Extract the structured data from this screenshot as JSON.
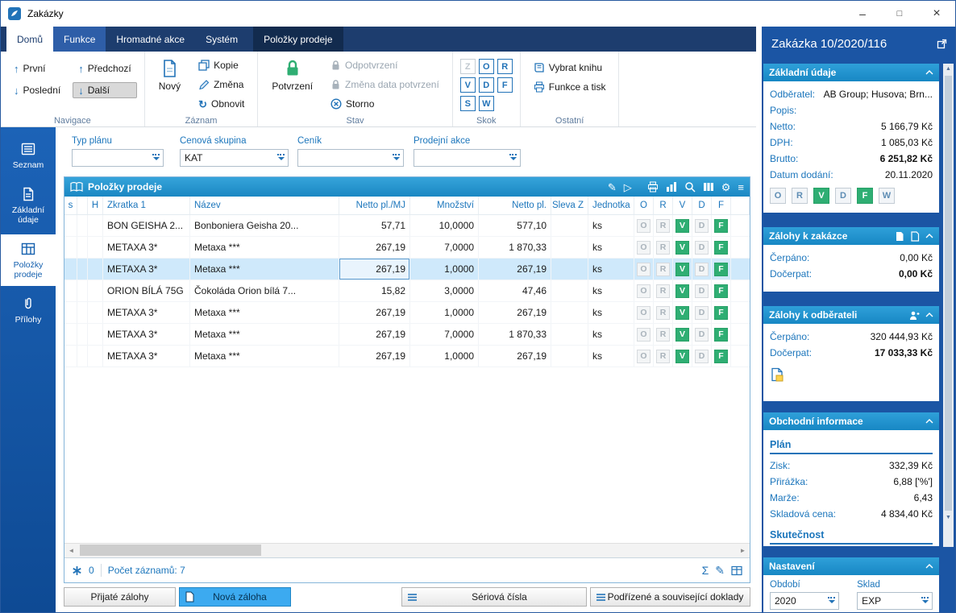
{
  "colors": {
    "ribbon_navy": "#1d3d6e",
    "sidebar_blue": "#1457a8",
    "panel_blue": "#1b55a4",
    "header_blue": "#1b8ac6",
    "label_blue": "#1c76bc",
    "accent_blue": "#2273b8",
    "status_green": "#2fae73",
    "selection_blue": "#cfe9fb"
  },
  "icons": {
    "arrow_up": "↑",
    "arrow_down": "↓",
    "refresh": "↻",
    "play": "▷",
    "gear": "⚙",
    "menu": "≡",
    "sum": "Σ",
    "pencil": "✎",
    "scroll_left": "◄",
    "scroll_right": "►",
    "scroll_up": "▲",
    "scroll_down": "▼",
    "close": "×",
    "maximize": "□",
    "minimize": "–"
  },
  "window": {
    "title": "Zakázky"
  },
  "ribbon": {
    "tabs": [
      {
        "label": "Domů"
      },
      {
        "label": "Funkce"
      },
      {
        "label": "Hromadné akce"
      },
      {
        "label": "Systém"
      },
      {
        "label": "Položky prodeje"
      }
    ],
    "groups": {
      "navigace": {
        "label": "Navigace",
        "first": "První",
        "previous": "Předchozí",
        "last": "Poslední",
        "next": "Další"
      },
      "zaznam": {
        "label": "Záznam",
        "new": "Nový",
        "copy": "Kopie",
        "change": "Změna",
        "refresh": "Obnovit"
      },
      "stav": {
        "label": "Stav",
        "confirm": "Potvrzení",
        "unconfirm": "Odpotvrzení",
        "change_date": "Změna data potvrzení",
        "storno": "Storno"
      },
      "skok": {
        "label": "Skok",
        "letters": [
          "Z",
          "O",
          "R",
          "V",
          "D",
          "F",
          "S",
          "W"
        ]
      },
      "ostatni": {
        "label": "Ostatní",
        "select_book": "Vybrat knihu",
        "functions_print": "Funkce a tisk"
      }
    }
  },
  "sidebar": {
    "items": [
      {
        "label": "Seznam"
      },
      {
        "label": "Základní údaje"
      },
      {
        "label": "Položky prodeje"
      },
      {
        "label": "Přílohy"
      }
    ]
  },
  "filters": [
    {
      "label": "Typ plánu",
      "value": ""
    },
    {
      "label": "Cenová skupina",
      "value": "KAT"
    },
    {
      "label": "Ceník",
      "value": ""
    },
    {
      "label": "Prodejní akce",
      "value": ""
    }
  ],
  "grid": {
    "title": "Položky prodeje",
    "columns": {
      "s": "s",
      "h": "H",
      "zkratka": "Zkratka 1",
      "nazev": "Název",
      "netto_mj": "Netto pl./MJ",
      "mnozstvi": "Množství",
      "netto": "Netto pl.",
      "sleva": "Sleva Z",
      "jednotka": "Jednotka"
    },
    "status_letters": [
      "O",
      "R",
      "V",
      "D",
      "F"
    ],
    "rows": [
      {
        "zkratka": "BON GEISHA 2...",
        "nazev": "Bonboniera Geisha 20...",
        "netto_mj": "57,71",
        "mnozstvi": "10,0000",
        "netto": "577,10",
        "sleva": "",
        "jednotka": "ks"
      },
      {
        "zkratka": "METAXA 3*",
        "nazev": "Metaxa ***",
        "netto_mj": "267,19",
        "mnozstvi": "7,0000",
        "netto": "1 870,33",
        "sleva": "",
        "jednotka": "ks"
      },
      {
        "zkratka": "METAXA 3*",
        "nazev": "Metaxa ***",
        "netto_mj": "267,19",
        "mnozstvi": "1,0000",
        "netto": "267,19",
        "sleva": "",
        "jednotka": "ks"
      },
      {
        "zkratka": "ORION BÍLÁ 75G",
        "nazev": "Čokoláda Orion bílá 7...",
        "netto_mj": "15,82",
        "mnozstvi": "3,0000",
        "netto": "47,46",
        "sleva": "",
        "jednotka": "ks"
      },
      {
        "zkratka": "METAXA 3*",
        "nazev": "Metaxa ***",
        "netto_mj": "267,19",
        "mnozstvi": "1,0000",
        "netto": "267,19",
        "sleva": "",
        "jednotka": "ks"
      },
      {
        "zkratka": "METAXA 3*",
        "nazev": "Metaxa ***",
        "netto_mj": "267,19",
        "mnozstvi": "7,0000",
        "netto": "1 870,33",
        "sleva": "",
        "jednotka": "ks"
      },
      {
        "zkratka": "METAXA 3*",
        "nazev": "Metaxa ***",
        "netto_mj": "267,19",
        "mnozstvi": "1,0000",
        "netto": "267,19",
        "sleva": "",
        "jednotka": "ks"
      }
    ],
    "footer": {
      "counter": "0",
      "records": "Počet záznamů: 7"
    }
  },
  "bottom_buttons": {
    "prijate_zalohy": "Přijaté zálohy",
    "nova_zaloha": "Nová záloha",
    "seriova_cisla": "Sériová čísla",
    "podrizene": "Podřízené a související doklady"
  },
  "panel": {
    "title": "Zakázka 10/2020/116",
    "zakladni": {
      "title": "Základní údaje",
      "fields": [
        {
          "label": "Odběratel:",
          "value": "AB Group; Husova; Brn..."
        },
        {
          "label": "Popis:",
          "value": ""
        },
        {
          "label": "Netto:",
          "value": "5 166,79 Kč"
        },
        {
          "label": "DPH:",
          "value": "1 085,03 Kč"
        },
        {
          "label": "Brutto:",
          "value": "6 251,82 Kč"
        },
        {
          "label": "Datum dodání:",
          "value": "20.11.2020"
        }
      ],
      "status_letters": [
        "O",
        "R",
        "V",
        "D",
        "F",
        "W"
      ]
    },
    "zalohy_zakazka": {
      "title": "Zálohy k zakázce",
      "fields": [
        {
          "label": "Čerpáno:",
          "value": "0,00 Kč"
        },
        {
          "label": "Dočerpat:",
          "value": "0,00 Kč"
        }
      ]
    },
    "zalohy_odberatel": {
      "title": "Zálohy k odběrateli",
      "fields": [
        {
          "label": "Čerpáno:",
          "value": "320 444,93 Kč"
        },
        {
          "label": "Dočerpat:",
          "value": "17 033,33 Kč"
        }
      ]
    },
    "obchodni": {
      "title": "Obchodní informace",
      "plan_title": "Plán",
      "fields": [
        {
          "label": "Zisk:",
          "value": "332,39 Kč"
        },
        {
          "label": "Přirážka:",
          "value": "6,88 ['%']"
        },
        {
          "label": "Marže:",
          "value": "6,43"
        },
        {
          "label": "Skladová cena:",
          "value": "4 834,40 Kč"
        }
      ],
      "skutecnost_title": "Skutečnost"
    },
    "nastaveni": {
      "title": "Nastavení",
      "obdobi_label": "Období",
      "obdobi_value": "2020",
      "sklad_label": "Sklad",
      "sklad_value": "EXP"
    }
  }
}
